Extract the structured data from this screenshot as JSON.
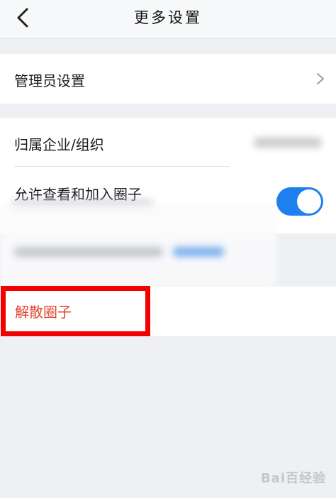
{
  "nav": {
    "title": "更多设置",
    "back_icon": "chevron-left-icon"
  },
  "settings": {
    "admin": {
      "label": "管理员设置",
      "icon": "chevron-right-icon"
    },
    "org": {
      "label": "归属企业/组织"
    },
    "allow_view_join": {
      "label": "允许查看和加入圈子",
      "enabled": true,
      "accent": "#1e80ee"
    },
    "dissolve": {
      "label": "解散圈子",
      "color": "#e0432f",
      "highlight_color": "#f30000"
    }
  },
  "watermark": {
    "text": "Bai百经验"
  }
}
